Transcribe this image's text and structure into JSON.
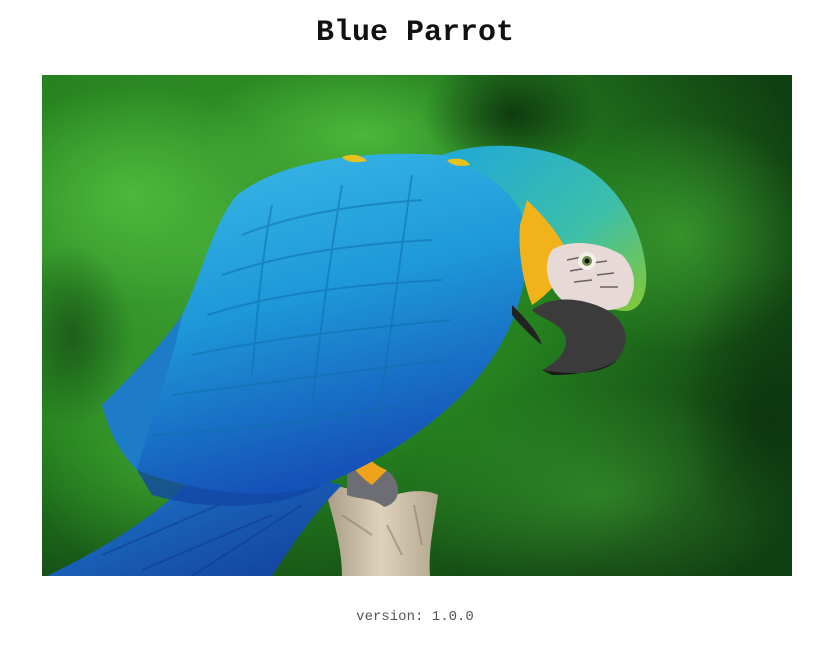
{
  "page": {
    "title": "Blue Parrot",
    "version_label": "version:",
    "version_value": "1.0.0"
  },
  "photo": {
    "subject": "blue-and-gold macaw perched on a branch",
    "colors": {
      "background_green": "#2f8a2a",
      "feather_blue": "#1fa2d8",
      "feather_deep_blue": "#1660c0",
      "chest_yellow": "#f2b21a",
      "crown_green": "#7cc23a",
      "beak_grey": "#3b3b3b",
      "branch": "#cfc3ad"
    }
  }
}
